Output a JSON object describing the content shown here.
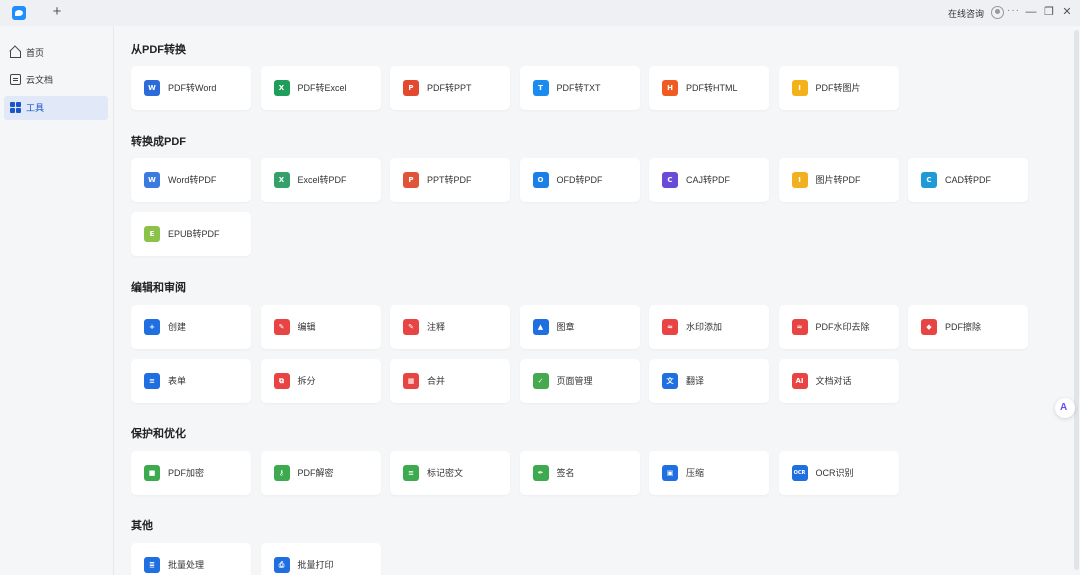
{
  "titlebar": {
    "consult": "在线咨询",
    "more": "···"
  },
  "sidebar": {
    "items": [
      {
        "label": "首页",
        "icon": "home-icon"
      },
      {
        "label": "云文档",
        "icon": "cloud-doc-icon"
      },
      {
        "label": "工具",
        "icon": "tools-grid-icon",
        "active": true
      }
    ]
  },
  "sections": {
    "from_pdf": {
      "title": "从PDF转换",
      "items": [
        {
          "label": "PDF转Word",
          "icon": "W",
          "color": "#2b6cd8"
        },
        {
          "label": "PDF转Excel",
          "icon": "X",
          "color": "#1e9e5a"
        },
        {
          "label": "PDF转PPT",
          "icon": "P",
          "color": "#e2492f"
        },
        {
          "label": "PDF转TXT",
          "icon": "T",
          "color": "#1a8cf0"
        },
        {
          "label": "PDF转HTML",
          "icon": "H",
          "color": "#f05a23"
        },
        {
          "label": "PDF转图片",
          "icon": "I",
          "color": "#f3b21a"
        }
      ]
    },
    "to_pdf": {
      "title": "转换成PDF",
      "items": [
        {
          "label": "Word转PDF",
          "icon": "W",
          "color": "#3b7be0"
        },
        {
          "label": "Excel转PDF",
          "icon": "X",
          "color": "#34a06a"
        },
        {
          "label": "PPT转PDF",
          "icon": "P",
          "color": "#e0553a"
        },
        {
          "label": "OFD转PDF",
          "icon": "O",
          "color": "#1a7fe6"
        },
        {
          "label": "CAJ转PDF",
          "icon": "C",
          "color": "#6a4bd8"
        },
        {
          "label": "图片转PDF",
          "icon": "I",
          "color": "#f0b020"
        },
        {
          "label": "CAD转PDF",
          "icon": "C",
          "color": "#1f9ad6"
        },
        {
          "label": "EPUB转PDF",
          "icon": "E",
          "color": "#8bc34a"
        }
      ]
    },
    "edit_review": {
      "title": "编辑和审阅",
      "items": [
        {
          "label": "创建",
          "icon": "+",
          "color": "#1f6fe0"
        },
        {
          "label": "编辑",
          "icon": "✎",
          "color": "#e84444"
        },
        {
          "label": "注释",
          "icon": "✎",
          "color": "#e84444"
        },
        {
          "label": "图章",
          "icon": "▲",
          "color": "#1f6fe0"
        },
        {
          "label": "水印添加",
          "icon": "≈",
          "color": "#e84444"
        },
        {
          "label": "PDF水印去除",
          "icon": "≈",
          "color": "#e84444"
        },
        {
          "label": "PDF擦除",
          "icon": "◆",
          "color": "#e84444"
        },
        {
          "label": "表单",
          "icon": "≡",
          "color": "#1f6fe0"
        },
        {
          "label": "拆分",
          "icon": "⧉",
          "color": "#e84444"
        },
        {
          "label": "合并",
          "icon": "▦",
          "color": "#e84444"
        },
        {
          "label": "页面管理",
          "icon": "✓",
          "color": "#46a84f"
        },
        {
          "label": "翻译",
          "icon": "文",
          "color": "#1f6fe0"
        },
        {
          "label": "文档对话",
          "icon": "AI",
          "color": "#e84444"
        }
      ]
    },
    "protect": {
      "title": "保护和优化",
      "items": [
        {
          "label": "PDF加密",
          "icon": "■",
          "color": "#3eaa4f"
        },
        {
          "label": "PDF解密",
          "icon": "⚷",
          "color": "#3eaa4f"
        },
        {
          "label": "标记密文",
          "icon": "≡",
          "color": "#3eaa4f"
        },
        {
          "label": "签名",
          "icon": "✒",
          "color": "#3eaa4f"
        },
        {
          "label": "压缩",
          "icon": "▣",
          "color": "#1f6fe0"
        },
        {
          "label": "OCR识别",
          "icon": "OCR",
          "color": "#1f6fe0"
        }
      ]
    },
    "other": {
      "title": "其他",
      "items": [
        {
          "label": "批量处理",
          "icon": "≣",
          "color": "#1f6fe0"
        },
        {
          "label": "批量打印",
          "icon": "⎙",
          "color": "#1f6fe0"
        }
      ]
    }
  }
}
